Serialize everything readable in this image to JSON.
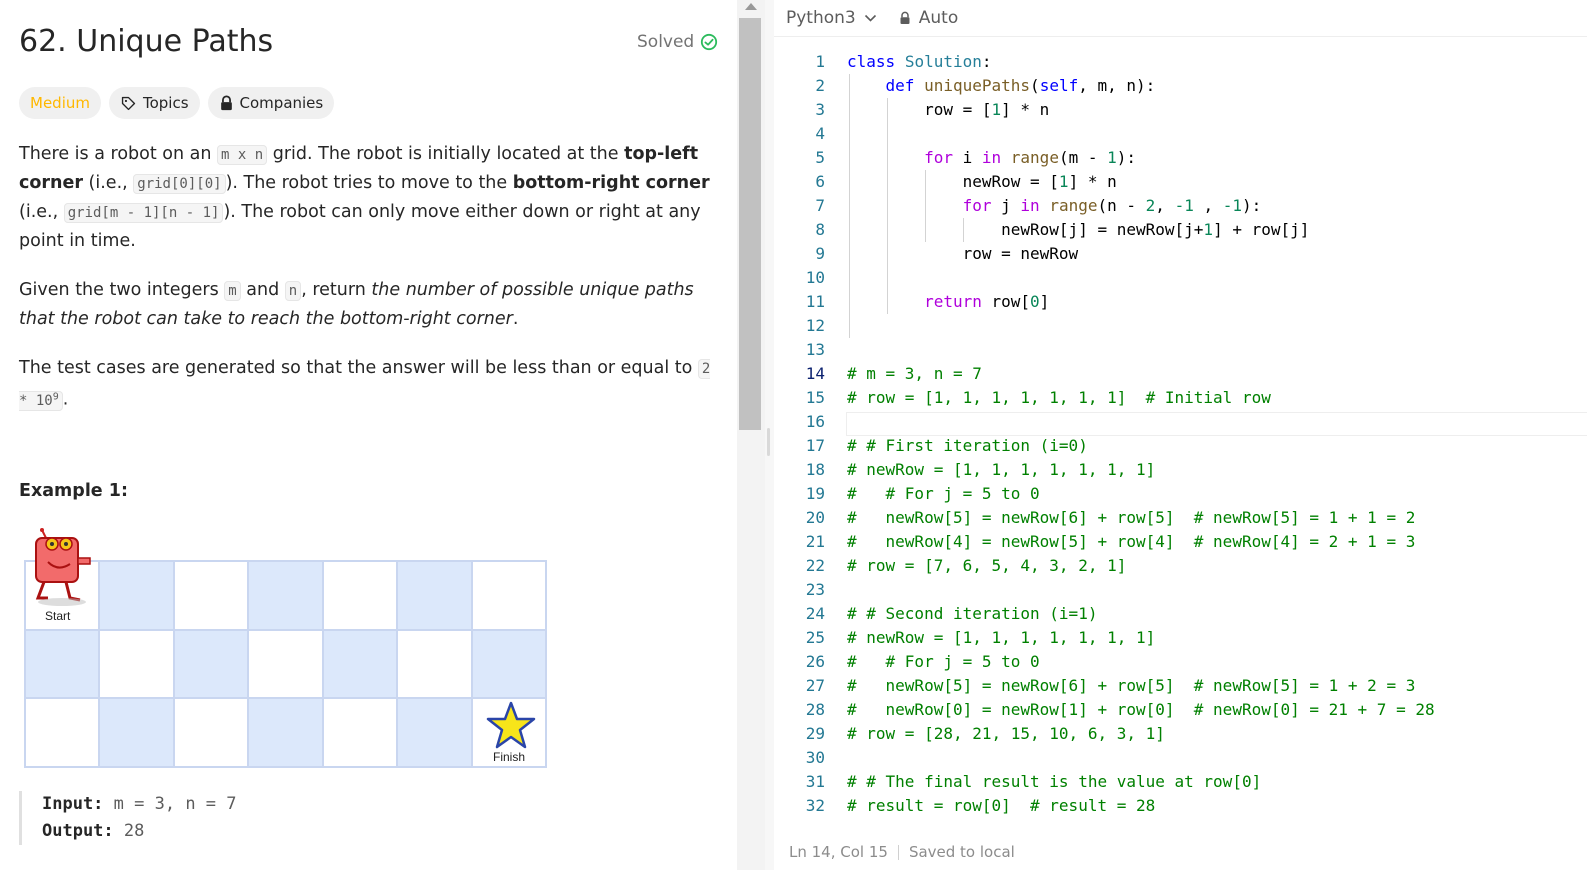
{
  "problem": {
    "title": "62. Unique Paths",
    "solved": "Solved",
    "tags": {
      "difficulty": "Medium",
      "topics": "Topics",
      "companies": "Companies"
    },
    "desc": {
      "p1": [
        "There is a robot on an ",
        "m x n",
        " grid. The robot is initially located at the ",
        "top-left corner",
        " (i.e., ",
        "grid[0][0]",
        "). The robot tries to move to the ",
        "bottom-right corner",
        " (i.e., ",
        "grid[m - 1][n - 1]",
        "). The robot can only move either down or right at any point in time."
      ],
      "p2": [
        "Given the two integers ",
        "m",
        " and ",
        "n",
        ", return ",
        "the number of possible unique paths that the robot can take to reach the bottom-right corner",
        "."
      ],
      "p3": [
        "The test cases are generated so that the answer will be less than or equal to ",
        "2 * 10",
        "9",
        "."
      ]
    },
    "example": {
      "title": "Example 1:",
      "start_label": "Start",
      "finish_label": "Finish",
      "input_label": "Input:",
      "input_value": "m = 3, n = 7",
      "output_label": "Output:",
      "output_value": "28"
    },
    "grid": {
      "rows": 3,
      "cols": 7
    }
  },
  "editor": {
    "language": "Python3",
    "mode": "Auto",
    "cursor_line": 14,
    "status": {
      "position": "Ln 14, Col 15",
      "saved": "Saved to local"
    },
    "lines": [
      [
        [
          "kw",
          "class"
        ],
        [
          "op",
          " "
        ],
        [
          "cls",
          "Solution"
        ],
        [
          "op",
          ":"
        ]
      ],
      [
        [
          "op",
          "    "
        ],
        [
          "kw",
          "def"
        ],
        [
          "op",
          " "
        ],
        [
          "fn",
          "uniquePaths"
        ],
        [
          "op",
          "("
        ],
        [
          "kw",
          "self"
        ],
        [
          "op",
          ", m, n):"
        ]
      ],
      [
        [
          "op",
          "        row = ["
        ],
        [
          "num",
          "1"
        ],
        [
          "op",
          "] * n"
        ]
      ],
      [],
      [
        [
          "op",
          "        "
        ],
        [
          "ctl",
          "for"
        ],
        [
          "op",
          " i "
        ],
        [
          "ctl",
          "in"
        ],
        [
          "op",
          " "
        ],
        [
          "fn",
          "range"
        ],
        [
          "op",
          "(m - "
        ],
        [
          "num",
          "1"
        ],
        [
          "op",
          "):"
        ]
      ],
      [
        [
          "op",
          "            newRow = ["
        ],
        [
          "num",
          "1"
        ],
        [
          "op",
          "] * n"
        ]
      ],
      [
        [
          "op",
          "            "
        ],
        [
          "ctl",
          "for"
        ],
        [
          "op",
          " j "
        ],
        [
          "ctl",
          "in"
        ],
        [
          "op",
          " "
        ],
        [
          "fn",
          "range"
        ],
        [
          "op",
          "(n - "
        ],
        [
          "num",
          "2"
        ],
        [
          "op",
          ", "
        ],
        [
          "num",
          "-1"
        ],
        [
          "op",
          " , "
        ],
        [
          "num",
          "-1"
        ],
        [
          "op",
          "):"
        ]
      ],
      [
        [
          "op",
          "                newRow[j] = newRow[j+"
        ],
        [
          "num",
          "1"
        ],
        [
          "op",
          "] + row[j]"
        ]
      ],
      [
        [
          "op",
          "            row = newRow"
        ]
      ],
      [],
      [
        [
          "op",
          "        "
        ],
        [
          "ctl",
          "return"
        ],
        [
          "op",
          " row["
        ],
        [
          "num",
          "0"
        ],
        [
          "op",
          "]"
        ]
      ],
      [],
      [],
      [
        [
          "cm",
          "# m = 3, n = 7"
        ]
      ],
      [
        [
          "cm",
          "# row = [1, 1, 1, 1, 1, 1, 1]  # Initial row"
        ]
      ],
      [],
      [
        [
          "cm",
          "# # First iteration (i=0)"
        ]
      ],
      [
        [
          "cm",
          "# newRow = [1, 1, 1, 1, 1, 1, 1]"
        ]
      ],
      [
        [
          "cm",
          "#   # For j = 5 to 0"
        ]
      ],
      [
        [
          "cm",
          "#   newRow[5] = newRow[6] + row[5]  # newRow[5] = 1 + 1 = 2"
        ]
      ],
      [
        [
          "cm",
          "#   newRow[4] = newRow[5] + row[4]  # newRow[4] = 2 + 1 = 3"
        ]
      ],
      [
        [
          "cm",
          "# row = [7, 6, 5, 4, 3, 2, 1]"
        ]
      ],
      [],
      [
        [
          "cm",
          "# # Second iteration (i=1)"
        ]
      ],
      [
        [
          "cm",
          "# newRow = [1, 1, 1, 1, 1, 1, 1]"
        ]
      ],
      [
        [
          "cm",
          "#   # For j = 5 to 0"
        ]
      ],
      [
        [
          "cm",
          "#   newRow[5] = newRow[6] + row[5]  # newRow[5] = 1 + 2 = 3"
        ]
      ],
      [
        [
          "cm",
          "#   newRow[0] = newRow[1] + row[0]  # newRow[0] = 21 + 7 = 28"
        ]
      ],
      [
        [
          "cm",
          "# row = [28, 21, 15, 10, 6, 3, 1]"
        ]
      ],
      [],
      [
        [
          "cm",
          "# # The final result is the value at row[0]"
        ]
      ],
      [
        [
          "cm",
          "# result = row[0]  # result = 28"
        ]
      ]
    ]
  }
}
